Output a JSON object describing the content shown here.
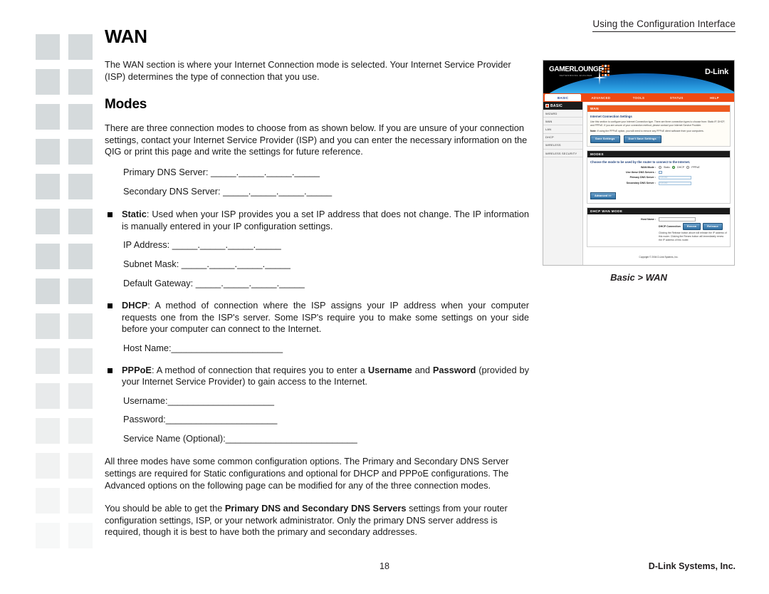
{
  "running_head": "Using the Configuration Interface",
  "headings": {
    "h1": "WAN",
    "h2": "Modes"
  },
  "paragraphs": {
    "intro": "The WAN section is where your Internet Connection mode is selected. Your Internet Service Provider (ISP) determines the type of connection that you use.",
    "modes_intro": "There are three connection modes to choose from as shown below. If you are unsure of your connection settings, contact your Internet Service Provider (ISP) and you can enter the necessary information on the QIG or print this page and write the settings for future reference.",
    "common_options": "All three modes have some common configuration options. The Primary and Secondary DNS Server settings are required for Static configurations and optional for DHCP and PPPoE configurations. The Advanced options on the following page can be modified for any of the three connection modes.",
    "dns_advice_pre": "You should be able to get the ",
    "dns_advice_bold": "Primary DNS and Secondary DNS Servers",
    "dns_advice_post": " settings from your router configuration settings, ISP, or your network administrator. Only the primary DNS server address is required, though it is best to have both the primary and secondary addresses."
  },
  "fields": {
    "primary_dns": "Primary DNS Server: _____._____._____._____",
    "secondary_dns": "Secondary DNS Server: _____._____._____._____",
    "ip_address": "IP Address: _____._____._____._____",
    "subnet_mask": "Subnet Mask: _____._____._____._____",
    "default_gateway": "Default Gateway: _____._____._____._____",
    "host_name": "Host Name:______________________",
    "username": "Username:_____________________",
    "password": "Password:______________________",
    "service_name": "Service Name (Optional):__________________________"
  },
  "modes": {
    "static": {
      "label": "Static",
      "text": ": Used when your ISP provides you a set IP address that does not change. The IP information is manually entered in your IP configuration settings."
    },
    "dhcp": {
      "label": "DHCP",
      "text": ": A method of connection where the ISP assigns your IP address when your computer requests one from the ISP's server. Some ISP's require you to make some settings on your side before your computer can connect to the Internet."
    },
    "pppoe": {
      "label": "PPPoE",
      "text_pre": ": A method of connection that requires you to enter a ",
      "bold1": "Username",
      "text_mid": " and ",
      "bold2": "Password",
      "text_post": " (provided by your Internet Service Provider) to gain access to the Internet."
    }
  },
  "figure": {
    "caption": "Basic > WAN",
    "banner": {
      "logo_primary": "GAMERLOUNGE",
      "logo_sub": "NETWORKING EVOLVED",
      "brand": "D-Link"
    },
    "nav_tabs": [
      {
        "label": "BASIC",
        "active": true
      },
      {
        "label": "ADVANCED",
        "active": false
      },
      {
        "label": "TOOLS",
        "active": false
      },
      {
        "label": "STATUS",
        "active": false
      },
      {
        "label": "HELP",
        "active": false
      }
    ],
    "sidebar": {
      "header": "BASIC",
      "items": [
        "WIZARD",
        "WAN",
        "LAN",
        "DHCP",
        "WIRELESS",
        "WIRELESS SECURITY"
      ]
    },
    "wan_panel": {
      "header": "WAN",
      "title": "Internet Connection Settings",
      "text": "Use this section to configure your Internet Connection type. There are three connection types to choose from: Static IP, DHCP, and PPPoE. If you are unsure of your connection method, please contact your Internet Service Provider.",
      "note_bold": "Note:",
      "note_text": " If using the PPPoE option, you will need to remove any PPPoE client software from your computers.",
      "save_button": "Save Settings",
      "dont_save_button": "Don't Save Settings"
    },
    "modes_panel": {
      "header": "MODES",
      "title": "Choose the mode to be used by the router to connect to the Internet.",
      "wan_mode_label": "WAN Mode :",
      "radio_static": "Static",
      "radio_dhcp": "DHCP",
      "radio_pppoe": "PPPoE",
      "selected_mode": "DHCP",
      "use_dns_label": "Use these DNS Servers :",
      "primary_dns_label": "Primary DNS Server :",
      "primary_dns_value": "0.0.0.0",
      "secondary_dns_label": "Secondary DNS Server :",
      "secondary_dns_value": "0.0.0.0",
      "advanced_button": "Advanced >>"
    },
    "dhcp_panel": {
      "header": "DHCP WAN MODE",
      "host_name_label": "Host Name :",
      "host_name_value": "",
      "connection_label": "DHCP Connection",
      "renew_button": "Renew",
      "release_button": "Release",
      "description": "Clicking the Release button above will release the IP address of this router. Clicking the Renew button will immediately renew the IP address of this router."
    },
    "copyright": "Copyright © 2004 D-Link Systems, Inc."
  },
  "footer": {
    "page_number": "18",
    "brand": "D-Link Systems, Inc."
  },
  "colors": {
    "orange": "#ee4a13",
    "panel_orange": "#ee5a1f",
    "dark": "#1b1b1b",
    "blue_button": "#2e6fa3",
    "deco_gray": "#d5dadc"
  }
}
